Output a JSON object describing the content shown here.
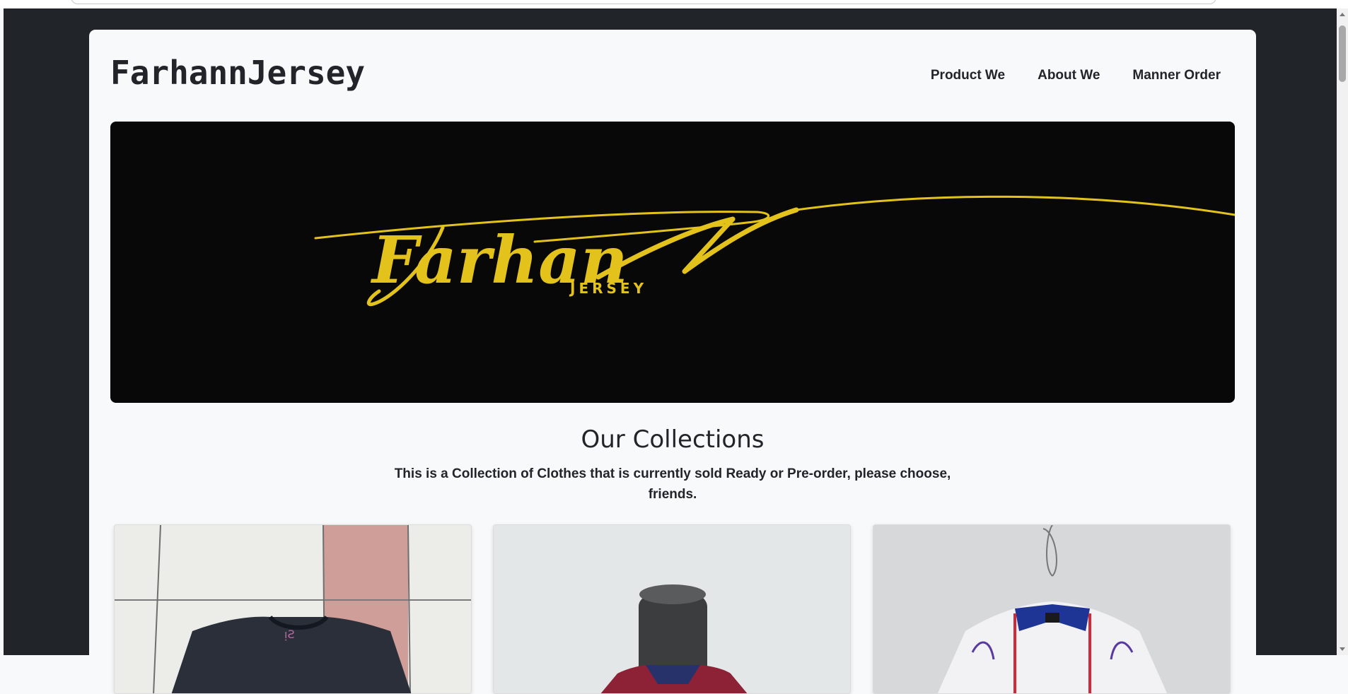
{
  "header": {
    "brand": "FarhannJersey",
    "nav": [
      {
        "label": "Product We"
      },
      {
        "label": "About We"
      },
      {
        "label": "Manner Order"
      }
    ]
  },
  "hero": {
    "logo_script_text": "Farhan",
    "logo_sub_text": "JERSEY",
    "colors": {
      "background": "#080808",
      "gold": "#e3c21c"
    }
  },
  "collections": {
    "title": "Our Collections",
    "description": "This is a Collection of Clothes that is currently sold Ready or Pre-order, please choose, friends."
  },
  "products": [
    {
      "image": "dark-jersey-on-tile-floor"
    },
    {
      "image": "red-blue-jersey-on-mannequin"
    },
    {
      "image": "white-blue-jersey-on-hanger"
    }
  ]
}
